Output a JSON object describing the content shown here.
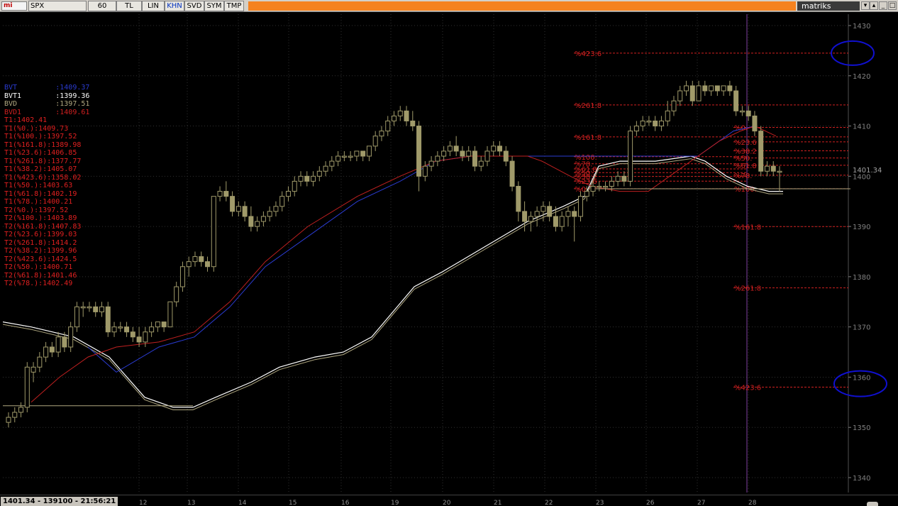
{
  "toolbar": {
    "logo": "mi",
    "symbol": "SPX",
    "buttons": [
      {
        "label": "60",
        "active": false
      },
      {
        "label": "TL",
        "active": false
      },
      {
        "label": "LIN",
        "active": false
      },
      {
        "label": "KHN",
        "active": true
      },
      {
        "label": "SVD",
        "active": false
      },
      {
        "label": "SYM",
        "active": false
      },
      {
        "label": "TMP",
        "active": false
      }
    ],
    "brand": "matriks",
    "window_buttons": [
      "▾",
      "▴",
      "_",
      "□",
      "×"
    ]
  },
  "status": {
    "readout": "1401.34 - 139100 - 21:56:21",
    "dates": [
      "12",
      "13",
      "14",
      "15",
      "16",
      "19",
      "20",
      "21",
      "22",
      "23",
      "26",
      "27",
      "28"
    ]
  },
  "legend": [
    {
      "text": "BVT         :1409.37",
      "color": "#2a3bd0"
    },
    {
      "text": "BVT1        :1399.36",
      "color": "#ffffff"
    },
    {
      "text": "BVD         :1397.51",
      "color": "#b0a880"
    },
    {
      "text": "BVD1        :1409.61",
      "color": "#d02020"
    },
    {
      "text": "T1:1402.41",
      "color": "#e02020"
    },
    {
      "text": "T1(%0.):1409.73",
      "color": "#e02020"
    },
    {
      "text": "T1(%100.):1397.52",
      "color": "#e02020"
    },
    {
      "text": "T1(%161.8):1389.98",
      "color": "#e02020"
    },
    {
      "text": "T1(%23.6):1406.85",
      "color": "#e02020"
    },
    {
      "text": "T1(%261.8):1377.77",
      "color": "#e02020"
    },
    {
      "text": "T1(%38.2):1405.07",
      "color": "#e02020"
    },
    {
      "text": "T1(%423.6):1358.02",
      "color": "#e02020"
    },
    {
      "text": "T1(%50.):1403.63",
      "color": "#e02020"
    },
    {
      "text": "T1(%61.8):1402.19",
      "color": "#e02020"
    },
    {
      "text": "T1(%78.):1400.21",
      "color": "#e02020"
    },
    {
      "text": "T2(%0.):1397.52",
      "color": "#e02020"
    },
    {
      "text": "T2(%100.):1403.89",
      "color": "#e02020"
    },
    {
      "text": "T2(%161.8):1407.83",
      "color": "#e02020"
    },
    {
      "text": "T2(%23.6):1399.03",
      "color": "#e02020"
    },
    {
      "text": "T2(%261.8):1414.2",
      "color": "#e02020"
    },
    {
      "text": "T2(%38.2):1399.96",
      "color": "#e02020"
    },
    {
      "text": "T2(%423.6):1424.5",
      "color": "#e02020"
    },
    {
      "text": "T2(%50.):1400.71",
      "color": "#e02020"
    },
    {
      "text": "T2(%61.8):1401.46",
      "color": "#e02020"
    },
    {
      "text": "T2(%78.):1402.49",
      "color": "#e02020"
    }
  ],
  "chart_data": {
    "type": "candlestick",
    "symbol": "SPX",
    "y_axis": {
      "ticks": [
        1430,
        1420,
        1410,
        1400,
        1390,
        1380,
        1370,
        1360,
        1350,
        1340
      ],
      "range": [
        1336,
        1432
      ]
    },
    "last_price": 1401.34,
    "last_price_label": "1401.34",
    "candles": [
      [
        1351,
        1353,
        1350,
        1352
      ],
      [
        1352,
        1354,
        1351,
        1353
      ],
      [
        1353,
        1355,
        1352,
        1354
      ],
      [
        1354,
        1363,
        1353,
        1362
      ],
      [
        1361,
        1363,
        1359,
        1362
      ],
      [
        1362,
        1365,
        1361,
        1364
      ],
      [
        1364,
        1367,
        1363,
        1366
      ],
      [
        1366,
        1367,
        1364,
        1365
      ],
      [
        1365,
        1369,
        1364,
        1368
      ],
      [
        1368,
        1369,
        1365,
        1366
      ],
      [
        1366,
        1371,
        1365,
        1370
      ],
      [
        1370,
        1375,
        1369,
        1374
      ],
      [
        1374,
        1375,
        1372,
        1374
      ],
      [
        1374,
        1375,
        1373,
        1374
      ],
      [
        1374,
        1375,
        1372,
        1373
      ],
      [
        1373,
        1375,
        1372,
        1374
      ],
      [
        1374,
        1375,
        1368,
        1369
      ],
      [
        1369,
        1371,
        1368,
        1370
      ],
      [
        1370,
        1371,
        1369,
        1370
      ],
      [
        1370,
        1371,
        1368,
        1369
      ],
      [
        1369,
        1370,
        1367,
        1368
      ],
      [
        1368,
        1370,
        1366,
        1367
      ],
      [
        1367,
        1370,
        1366,
        1369
      ],
      [
        1369,
        1371,
        1368,
        1370
      ],
      [
        1370,
        1371,
        1369,
        1371
      ],
      [
        1371,
        1371,
        1369,
        1370
      ],
      [
        1370,
        1375,
        1370,
        1375
      ],
      [
        1375,
        1379,
        1374,
        1378
      ],
      [
        1378,
        1383,
        1377,
        1382
      ],
      [
        1382,
        1384,
        1380,
        1383
      ],
      [
        1383,
        1385,
        1382,
        1384
      ],
      [
        1384,
        1385,
        1382,
        1383
      ],
      [
        1383,
        1384,
        1381,
        1382
      ],
      [
        1382,
        1396,
        1381,
        1396
      ],
      [
        1396,
        1398,
        1395,
        1397
      ],
      [
        1397,
        1399,
        1395,
        1396
      ],
      [
        1396,
        1397,
        1392,
        1393
      ],
      [
        1393,
        1395,
        1392,
        1394
      ],
      [
        1394,
        1395,
        1391,
        1392
      ],
      [
        1392,
        1394,
        1389,
        1390
      ],
      [
        1390,
        1392,
        1389,
        1391
      ],
      [
        1391,
        1393,
        1390,
        1392
      ],
      [
        1392,
        1394,
        1391,
        1393
      ],
      [
        1393,
        1395,
        1392,
        1394
      ],
      [
        1394,
        1397,
        1393,
        1396
      ],
      [
        1396,
        1398,
        1395,
        1397
      ],
      [
        1397,
        1400,
        1396,
        1399
      ],
      [
        1399,
        1401,
        1398,
        1400
      ],
      [
        1400,
        1401,
        1398,
        1399
      ],
      [
        1399,
        1401,
        1398,
        1400
      ],
      [
        1400,
        1402,
        1399,
        1401
      ],
      [
        1401,
        1403,
        1400,
        1402
      ],
      [
        1402,
        1404,
        1401,
        1403
      ],
      [
        1403,
        1405,
        1402,
        1404
      ],
      [
        1404,
        1405,
        1403,
        1404
      ],
      [
        1404,
        1405,
        1403,
        1404
      ],
      [
        1404,
        1405,
        1403,
        1405
      ],
      [
        1405,
        1405,
        1403,
        1404
      ],
      [
        1404,
        1406,
        1403,
        1406
      ],
      [
        1406,
        1409,
        1405,
        1408
      ],
      [
        1408,
        1410,
        1407,
        1409
      ],
      [
        1409,
        1412,
        1408,
        1411
      ],
      [
        1411,
        1413,
        1410,
        1412
      ],
      [
        1412,
        1414,
        1411,
        1413
      ],
      [
        1413,
        1414,
        1410,
        1411
      ],
      [
        1411,
        1413,
        1409,
        1410
      ],
      [
        1410,
        1411,
        1397,
        1400
      ],
      [
        1400,
        1403,
        1399,
        1402
      ],
      [
        1402,
        1404,
        1401,
        1403
      ],
      [
        1403,
        1405,
        1402,
        1404
      ],
      [
        1404,
        1406,
        1403,
        1405
      ],
      [
        1405,
        1407,
        1404,
        1406
      ],
      [
        1406,
        1408,
        1404,
        1405
      ],
      [
        1405,
        1406,
        1403,
        1404
      ],
      [
        1404,
        1406,
        1403,
        1405
      ],
      [
        1405,
        1406,
        1401,
        1402
      ],
      [
        1402,
        1404,
        1401,
        1403
      ],
      [
        1403,
        1406,
        1402,
        1405
      ],
      [
        1405,
        1407,
        1404,
        1406
      ],
      [
        1406,
        1407,
        1404,
        1405
      ],
      [
        1405,
        1406,
        1402,
        1403
      ],
      [
        1403,
        1404,
        1397,
        1398
      ],
      [
        1398,
        1399,
        1391,
        1393
      ],
      [
        1393,
        1395,
        1389,
        1391
      ],
      [
        1391,
        1393,
        1389,
        1392
      ],
      [
        1392,
        1394,
        1390,
        1393
      ],
      [
        1393,
        1395,
        1391,
        1394
      ],
      [
        1394,
        1395,
        1391,
        1392
      ],
      [
        1392,
        1394,
        1389,
        1390
      ],
      [
        1390,
        1393,
        1389,
        1392
      ],
      [
        1392,
        1394,
        1390,
        1393
      ],
      [
        1393,
        1394,
        1387,
        1392
      ],
      [
        1392,
        1397,
        1391,
        1396
      ],
      [
        1396,
        1398,
        1395,
        1397
      ],
      [
        1397,
        1399,
        1396,
        1398
      ],
      [
        1398,
        1399,
        1397,
        1398
      ],
      [
        1398,
        1399,
        1397,
        1398
      ],
      [
        1398,
        1400,
        1397,
        1399
      ],
      [
        1399,
        1401,
        1398,
        1400
      ],
      [
        1400,
        1401,
        1398,
        1399
      ],
      [
        1399,
        1410,
        1398,
        1409
      ],
      [
        1409,
        1411,
        1408,
        1410
      ],
      [
        1410,
        1412,
        1409,
        1411
      ],
      [
        1411,
        1412,
        1410,
        1411
      ],
      [
        1411,
        1412,
        1409,
        1410
      ],
      [
        1410,
        1412,
        1409,
        1411
      ],
      [
        1411,
        1415,
        1410,
        1413
      ],
      [
        1413,
        1416,
        1412,
        1415
      ],
      [
        1415,
        1418,
        1414,
        1417
      ],
      [
        1417,
        1419,
        1416,
        1418
      ],
      [
        1418,
        1419,
        1414,
        1415
      ],
      [
        1415,
        1419,
        1415,
        1418
      ],
      [
        1418,
        1419,
        1416,
        1417
      ],
      [
        1417,
        1418,
        1416,
        1418
      ],
      [
        1418,
        1418,
        1416,
        1417
      ],
      [
        1417,
        1418,
        1416,
        1418
      ],
      [
        1418,
        1419,
        1416,
        1417
      ],
      [
        1417,
        1418,
        1412,
        1413
      ],
      [
        1413,
        1414,
        1412,
        1413
      ],
      [
        1413,
        1414,
        1411,
        1412
      ],
      [
        1412,
        1413,
        1408,
        1409
      ],
      [
        1409,
        1410,
        1400,
        1401
      ],
      [
        1401,
        1403,
        1400,
        1402
      ],
      [
        1402,
        1403,
        1400,
        1401
      ],
      [
        1401,
        1402,
        1397,
        1401
      ]
    ],
    "fib_retracement_1": {
      "levels": [
        "%0.",
        "%23.6",
        "%38.2",
        "%50.",
        "%61.8",
        "%78.",
        "%100."
      ],
      "values": [
        1397.52,
        1399.03,
        1399.96,
        1400.71,
        1401.46,
        1402.49,
        1403.89
      ]
    },
    "fib_extension_1": [
      {
        "label": "%161.8",
        "value": 1407.83
      },
      {
        "label": "%261.8",
        "value": 1414.2
      },
      {
        "label": "%423.6",
        "value": 1424.5
      }
    ],
    "fib_retracement_2": {
      "levels": [
        "%0.",
        "%23.6",
        "%38.2",
        "%50.",
        "%61.8",
        "%78.",
        "%100."
      ],
      "values": [
        1409.73,
        1406.85,
        1405.07,
        1403.63,
        1402.19,
        1400.21,
        1397.52
      ]
    },
    "fib_extension_2": [
      {
        "label": "%161.8",
        "value": 1389.98
      },
      {
        "label": "%261.8",
        "value": 1377.77
      },
      {
        "label": "%423.6",
        "value": 1358.02
      }
    ],
    "colors": {
      "candle": "#a09a6a",
      "grid": "#303030",
      "fib": "#d02020",
      "axis_text": "#808080",
      "blue": "#2a3bd0",
      "red": "#c02020",
      "white": "#ffffff",
      "olive": "#b0a880",
      "marker": "#1010d0",
      "cursor": "#8040a0"
    }
  }
}
